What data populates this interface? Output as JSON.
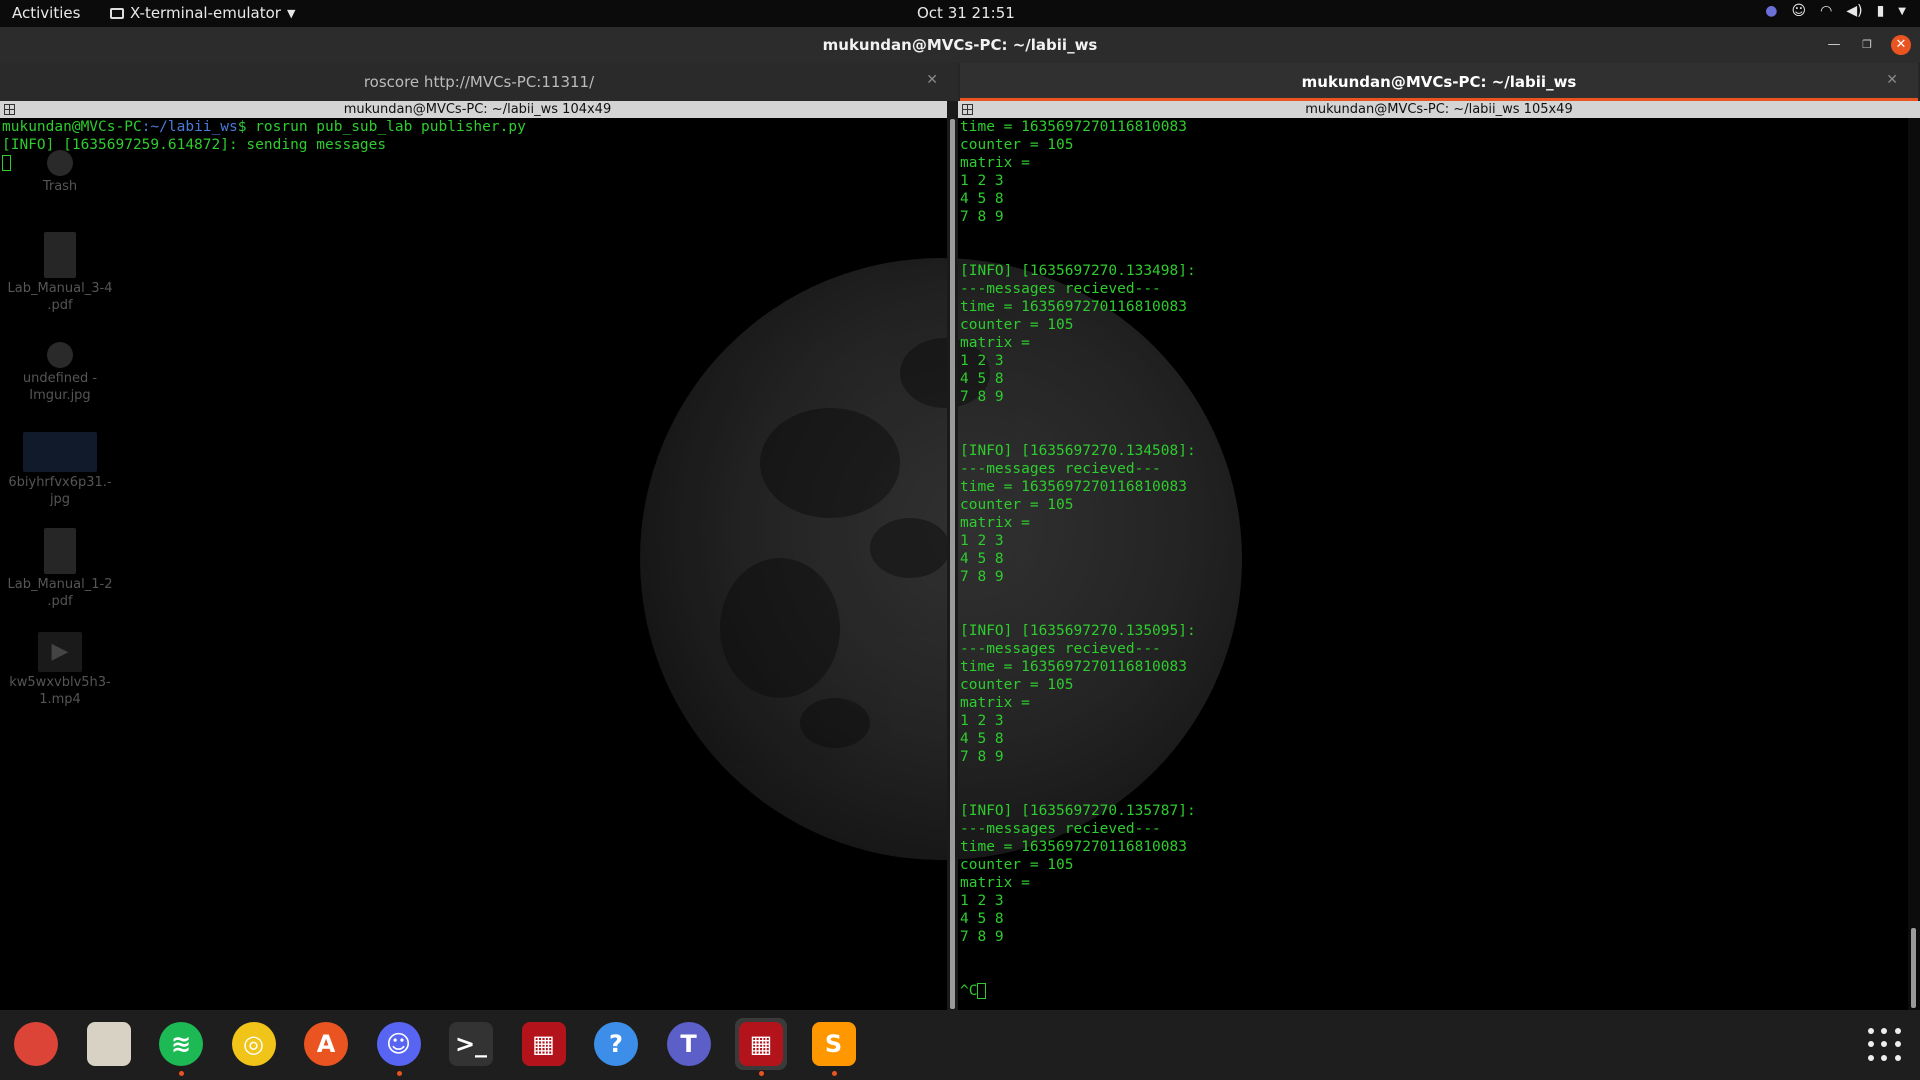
{
  "topbar": {
    "activities": "Activities",
    "app_menu": "X-terminal-emulator",
    "clock": "Oct 31  21:51"
  },
  "window": {
    "title": "mukundan@MVCs-PC: ~/labii_ws"
  },
  "tabs": [
    {
      "label": "roscore http://MVCs-PC:11311/",
      "active": false
    },
    {
      "label": "mukundan@MVCs-PC: ~/labii_ws",
      "active": true
    }
  ],
  "panes": {
    "left_header": "mukundan@MVCs-PC: ~/labii_ws 104x49",
    "right_header": "mukundan@MVCs-PC: ~/labii_ws 105x49",
    "left": {
      "prompt_user": "mukundan@MVCs-PC",
      "prompt_path": ":~/labii_ws",
      "command": "$ rosrun pub_sub_lab publisher.py",
      "output": "[INFO] [1635697259.614872]: sending messages"
    },
    "right_lines": [
      "time = 1635697270116810083",
      "counter = 105",
      "matrix =",
      "1 2 3",
      "4 5 8",
      "7 8 9",
      "",
      "",
      "[INFO] [1635697270.133498]:",
      "---messages recieved---",
      "time = 1635697270116810083",
      "counter = 105",
      "matrix =",
      "1 2 3",
      "4 5 8",
      "7 8 9",
      "",
      "",
      "[INFO] [1635697270.134508]:",
      "---messages recieved---",
      "time = 1635697270116810083",
      "counter = 105",
      "matrix =",
      "1 2 3",
      "4 5 8",
      "7 8 9",
      "",
      "",
      "[INFO] [1635697270.135095]:",
      "---messages recieved---",
      "time = 1635697270116810083",
      "counter = 105",
      "matrix =",
      "1 2 3",
      "4 5 8",
      "7 8 9",
      "",
      "",
      "[INFO] [1635697270.135787]:",
      "---messages recieved---",
      "time = 1635697270116810083",
      "counter = 105",
      "matrix =",
      "1 2 3",
      "4 5 8",
      "7 8 9",
      "",
      ""
    ],
    "right_last": "^C"
  },
  "desktop_icons": [
    {
      "label": "Trash"
    },
    {
      "label": "Lab_Manual_3-4\n.pdf"
    },
    {
      "label": "undefined -\nImgur.jpg"
    },
    {
      "label": "6biyhrfvx6p31.-\njpg"
    },
    {
      "label": "Lab_Manual_1-2\n.pdf"
    },
    {
      "label": "kw5wxvblv5h3-\n1.mp4"
    }
  ],
  "dock": [
    {
      "name": "chrome-icon",
      "glyph": "",
      "color": "#db4437",
      "running": false
    },
    {
      "name": "files-icon",
      "glyph": "",
      "color": "#d8d2c4",
      "running": false
    },
    {
      "name": "spotify-icon",
      "glyph": "≋",
      "color": "#1db954",
      "running": true
    },
    {
      "name": "rhythmbox-icon",
      "glyph": "◎",
      "color": "#f0c419",
      "running": false
    },
    {
      "name": "software-center-icon",
      "glyph": "A",
      "color": "#e95420",
      "running": false
    },
    {
      "name": "discord-icon",
      "glyph": "☺",
      "color": "#5865f2",
      "running": true
    },
    {
      "name": "terminal-icon",
      "glyph": ">_",
      "color": "#333333",
      "running": false
    },
    {
      "name": "terminator-icon",
      "glyph": "▦",
      "color": "#b3141c",
      "running": false
    },
    {
      "name": "help-icon",
      "glyph": "?",
      "color": "#3d8ee8",
      "running": false
    },
    {
      "name": "teams-icon",
      "glyph": "T",
      "color": "#5b5fc7",
      "running": false
    },
    {
      "name": "terminator-active-icon",
      "glyph": "▦",
      "color": "#b3141c",
      "running": true
    },
    {
      "name": "sublime-text-icon",
      "glyph": "S",
      "color": "#ff9800",
      "running": true
    }
  ]
}
